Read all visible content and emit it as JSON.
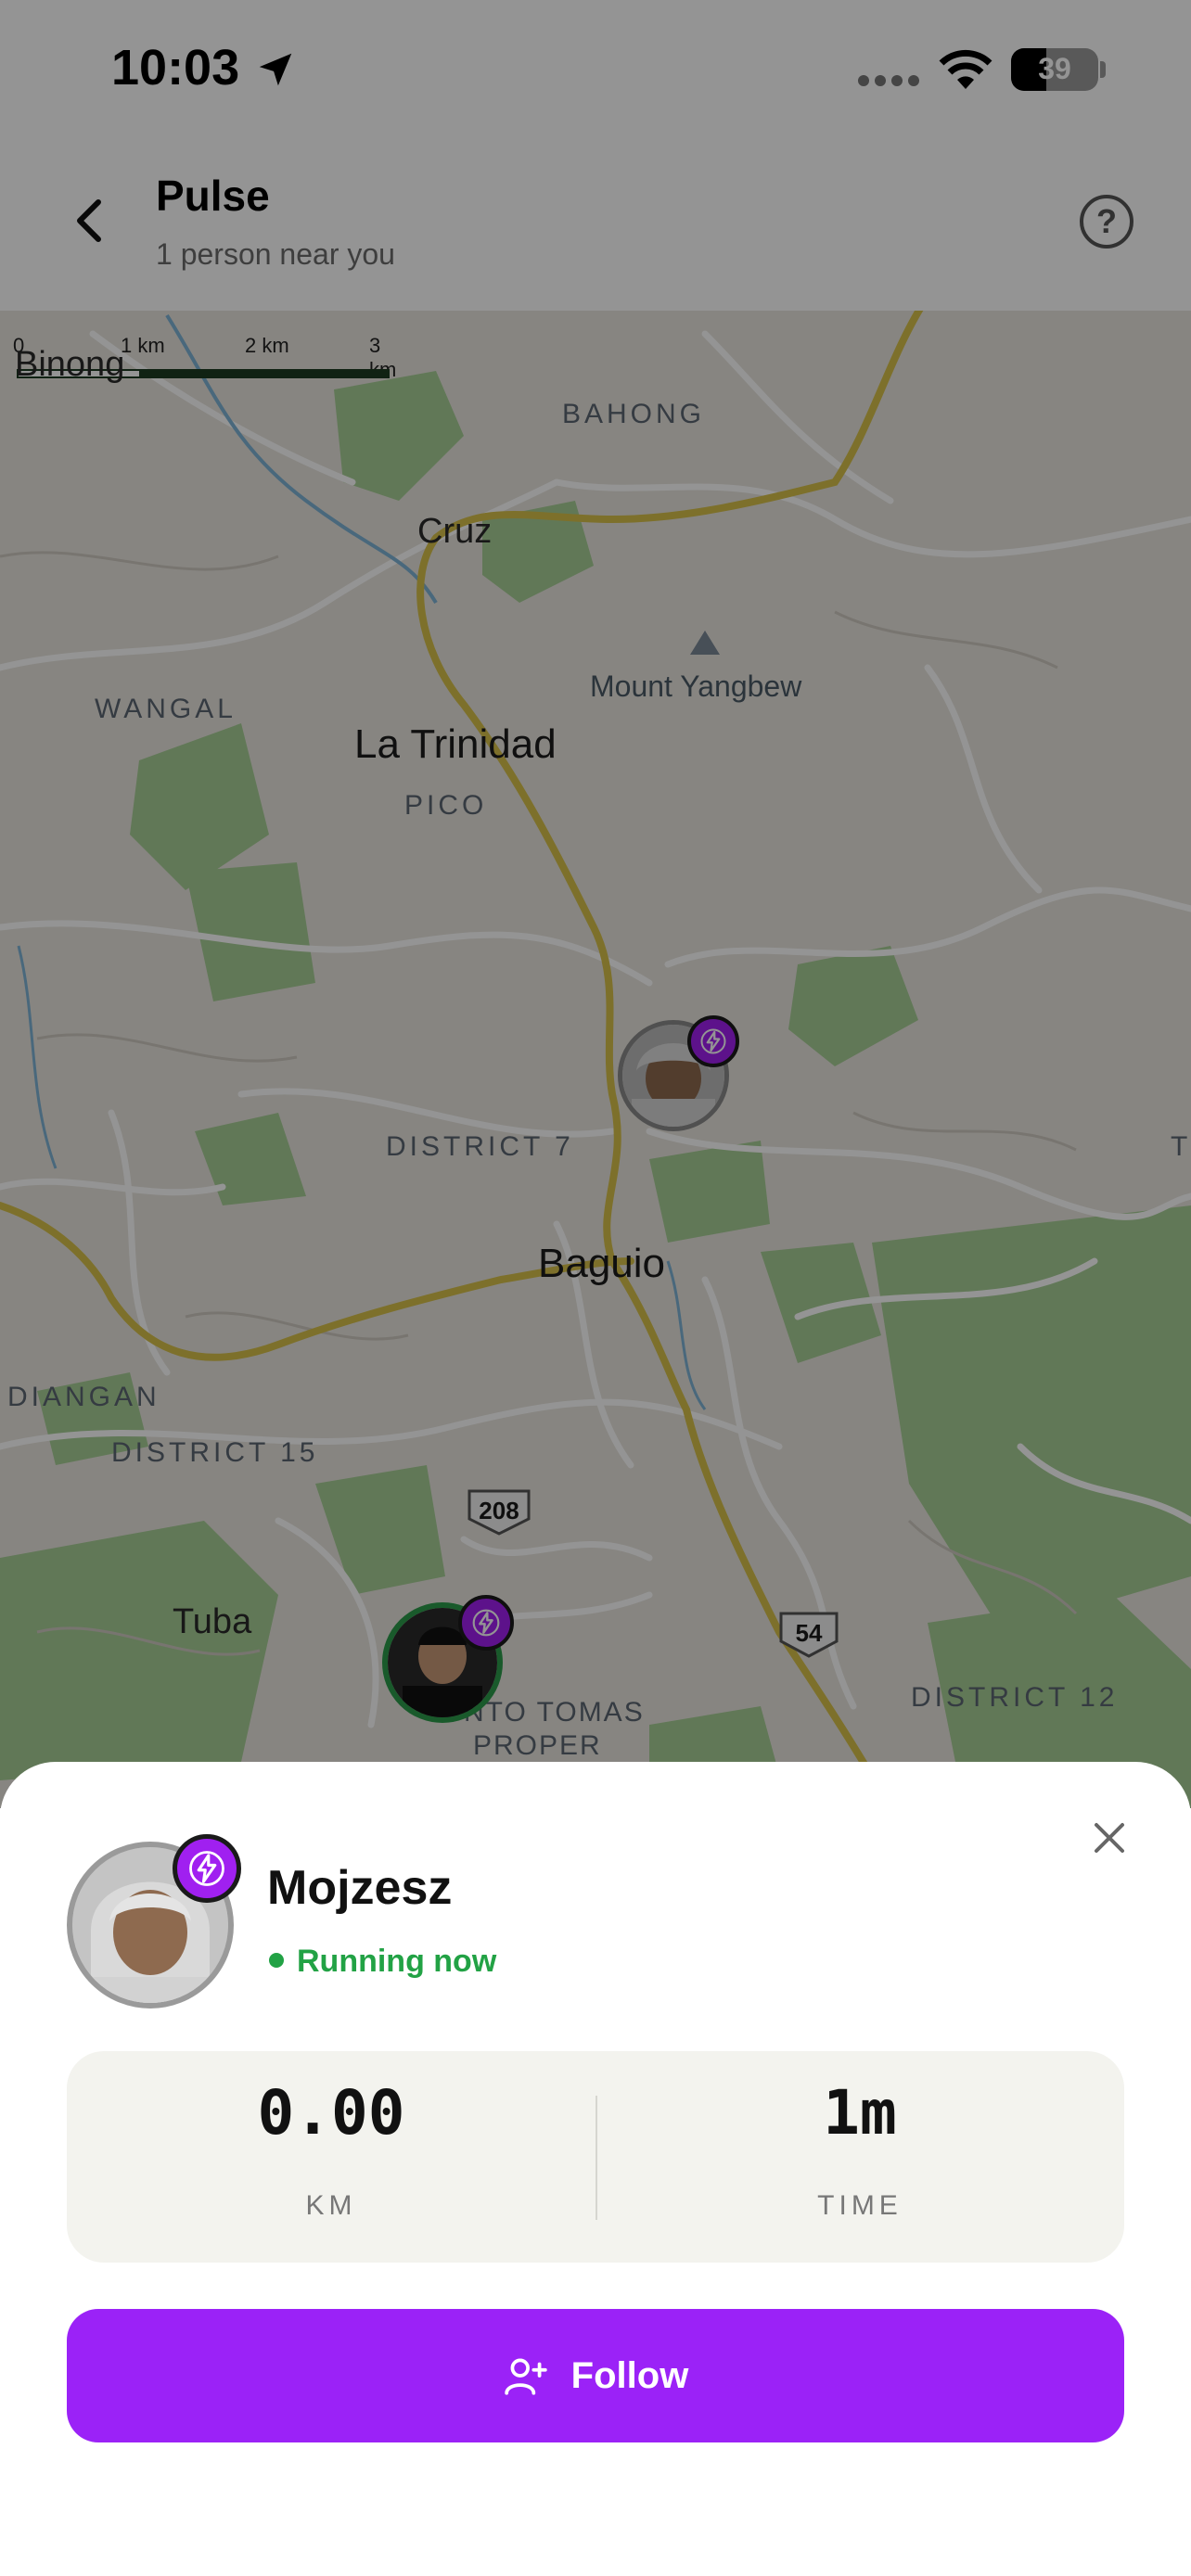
{
  "status_bar": {
    "time": "10:03",
    "battery": "39"
  },
  "header": {
    "title": "Pulse",
    "subtitle": "1 person near you"
  },
  "map": {
    "scale": [
      "0",
      "1 km",
      "2 km",
      "3 km"
    ],
    "labels": {
      "binong": "Binong",
      "bahong": "BAHONG",
      "cruz": "Cruz",
      "mount": "Mount Yangbew",
      "wangal": "WANGAL",
      "trinidad": "La Trinidad",
      "pico": "PICO",
      "district7": "DISTRICT 7",
      "baguio": "Baguio",
      "diangan": "DIANGAN",
      "district15": "DISTRICT 15",
      "tuba": "Tuba",
      "santotomas": "NTO TOMAS",
      "proper": "PROPER",
      "district12": "DISTRICT 12",
      "edge_t": "T"
    },
    "shields": {
      "route_a": "208",
      "route_b": "54"
    }
  },
  "sheet": {
    "name": "Mojzesz",
    "status": "Running now",
    "stats": [
      {
        "value": "0.00",
        "label": "KM"
      },
      {
        "value": "1m",
        "label": "TIME"
      }
    ],
    "follow_label": "Follow"
  },
  "colors": {
    "accent": "#9B22F7",
    "running": "#22A245",
    "map_green": "#9fc98f",
    "road_yellow": "#d8c24a"
  }
}
